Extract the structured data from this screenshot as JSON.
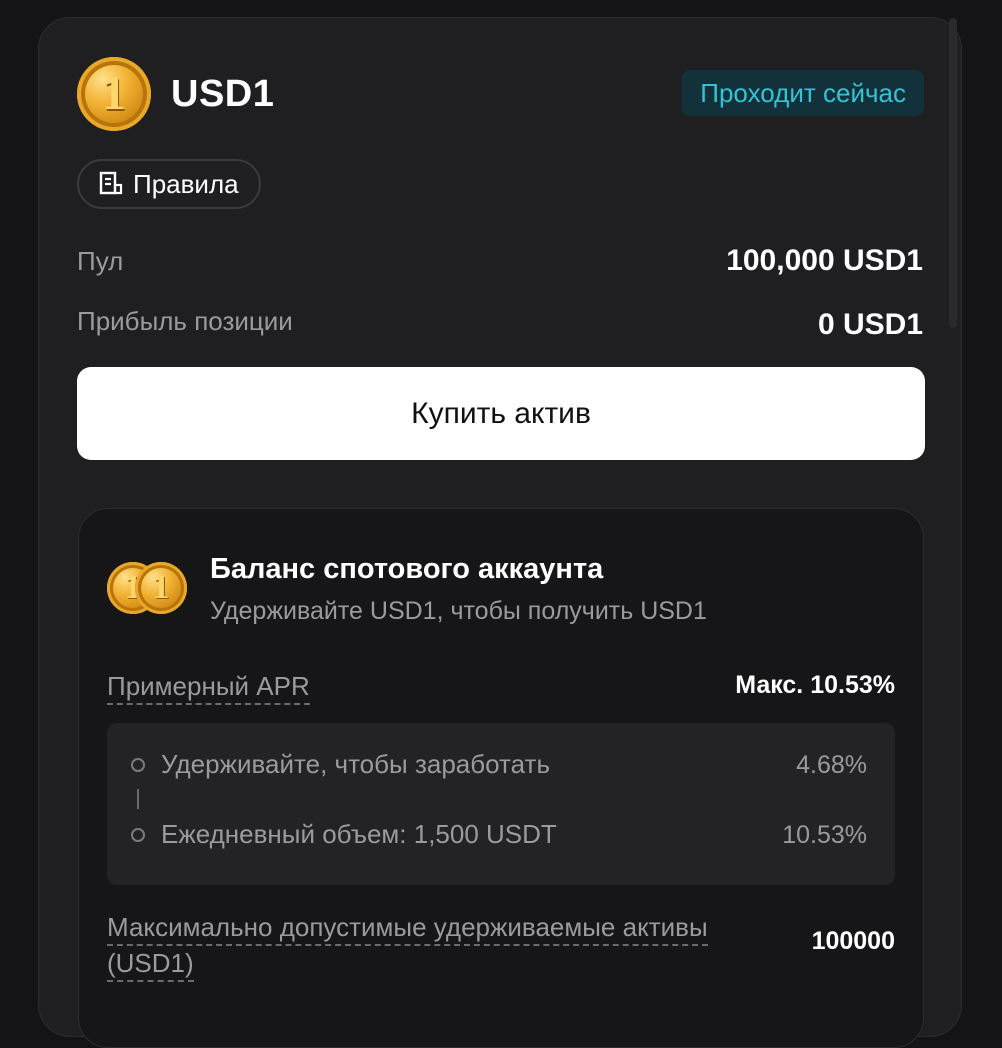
{
  "header": {
    "coin_symbol": "1",
    "title": "USD1",
    "status_badge": "Проходит сейчас",
    "rules_label": "Правила"
  },
  "stats": [
    {
      "label": "Пул",
      "value": "100,000 USD1"
    },
    {
      "label": "Прибыль позиции",
      "value": "0 USD1"
    }
  ],
  "buy_button": "Купить актив",
  "spot": {
    "title": "Баланс спотового аккаунта",
    "subtitle": "Удерживайте USD1, чтобы получить USD1",
    "apr_label": "Примерный APR",
    "apr_value": "Макс. 10.53%",
    "tiers": [
      {
        "label": "Удерживайте, чтобы заработать",
        "value": "4.68%"
      },
      {
        "label": "Ежедневный объем: 1,500 USDT",
        "value": "10.53%"
      }
    ],
    "max_label": "Максимально допустимые удерживаемые активы (USD1)",
    "max_value": "100000"
  },
  "colors": {
    "background": "#141416",
    "card": "#1f1f22",
    "badge_bg": "#12313a",
    "badge_text": "#35c3d4",
    "coin_gold": "#f2b233"
  }
}
